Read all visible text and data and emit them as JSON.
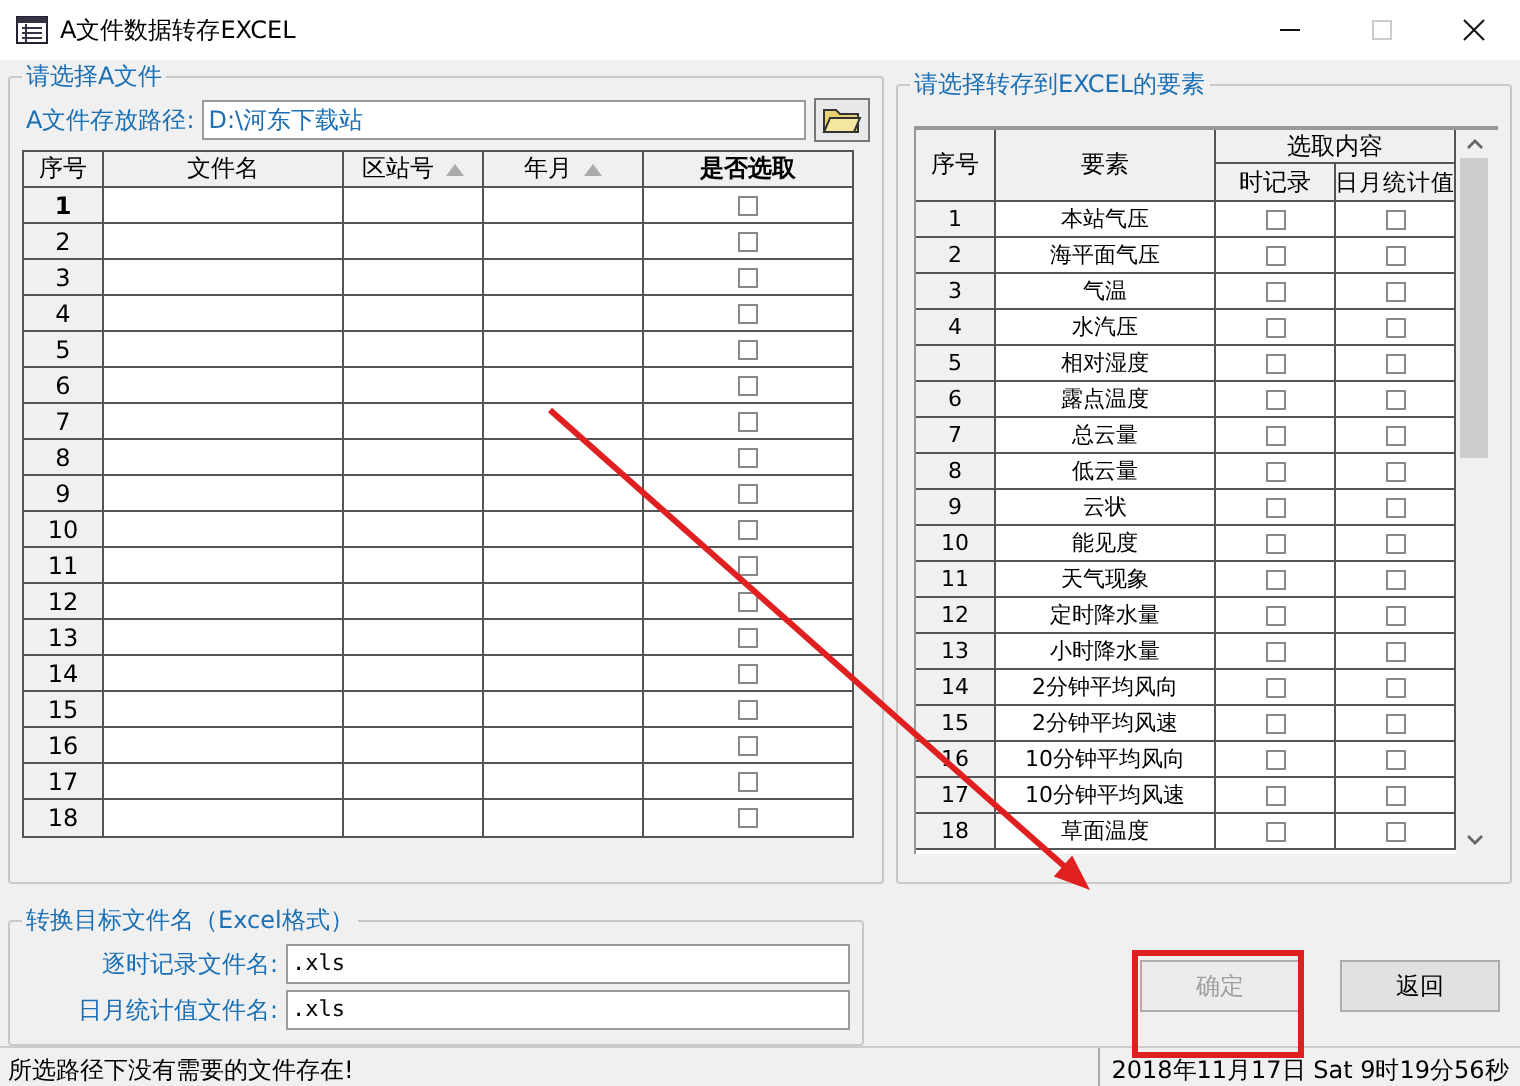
{
  "window": {
    "title": "A文件数据转存EXCEL",
    "maximize_disabled": true
  },
  "file_group": {
    "title": "请选择A文件",
    "path_label": "A文件存放路径:",
    "path_value": "D:\\河东下载站",
    "columns": [
      {
        "label": "序号",
        "sortable": false,
        "bold": false
      },
      {
        "label": "文件名",
        "sortable": false,
        "bold": false
      },
      {
        "label": "区站号",
        "sortable": true,
        "bold": false
      },
      {
        "label": "年月",
        "sortable": true,
        "bold": false
      },
      {
        "label": "是否选取",
        "sortable": false,
        "bold": true
      }
    ],
    "rows": [
      {
        "no": "1",
        "current": true,
        "checked": false
      },
      {
        "no": "2",
        "current": false,
        "checked": false
      },
      {
        "no": "3",
        "current": false,
        "checked": false
      },
      {
        "no": "4",
        "current": false,
        "checked": false
      },
      {
        "no": "5",
        "current": false,
        "checked": false
      },
      {
        "no": "6",
        "current": false,
        "checked": false
      },
      {
        "no": "7",
        "current": false,
        "checked": false
      },
      {
        "no": "8",
        "current": false,
        "checked": false
      },
      {
        "no": "9",
        "current": false,
        "checked": false
      },
      {
        "no": "10",
        "current": false,
        "checked": false
      },
      {
        "no": "11",
        "current": false,
        "checked": false
      },
      {
        "no": "12",
        "current": false,
        "checked": false
      },
      {
        "no": "13",
        "current": false,
        "checked": false
      },
      {
        "no": "14",
        "current": false,
        "checked": false
      },
      {
        "no": "15",
        "current": false,
        "checked": false
      },
      {
        "no": "16",
        "current": false,
        "checked": false
      },
      {
        "no": "17",
        "current": false,
        "checked": false
      },
      {
        "no": "18",
        "current": false,
        "checked": false
      }
    ]
  },
  "element_group": {
    "title": "请选择转存到EXCEL的要素",
    "col_no": "序号",
    "col_name": "要素",
    "col_content": "选取内容",
    "col_hourly": "时记录",
    "col_daily": "日月统计值",
    "rows": [
      {
        "no": "1",
        "name": "本站气压",
        "hourly": false,
        "daily": false
      },
      {
        "no": "2",
        "name": "海平面气压",
        "hourly": false,
        "daily": false
      },
      {
        "no": "3",
        "name": "气温",
        "hourly": false,
        "daily": false
      },
      {
        "no": "4",
        "name": "水汽压",
        "hourly": false,
        "daily": false
      },
      {
        "no": "5",
        "name": "相对湿度",
        "hourly": false,
        "daily": false
      },
      {
        "no": "6",
        "name": "露点温度",
        "hourly": false,
        "daily": false
      },
      {
        "no": "7",
        "name": "总云量",
        "hourly": false,
        "daily": false
      },
      {
        "no": "8",
        "name": "低云量",
        "hourly": false,
        "daily": false
      },
      {
        "no": "9",
        "name": "云状",
        "hourly": false,
        "daily": false
      },
      {
        "no": "10",
        "name": "能见度",
        "hourly": false,
        "daily": false
      },
      {
        "no": "11",
        "name": "天气现象",
        "hourly": false,
        "daily": false
      },
      {
        "no": "12",
        "name": "定时降水量",
        "hourly": false,
        "daily": false
      },
      {
        "no": "13",
        "name": "小时降水量",
        "hourly": false,
        "daily": false
      },
      {
        "no": "14",
        "name": "2分钟平均风向",
        "hourly": false,
        "daily": false
      },
      {
        "no": "15",
        "name": "2分钟平均风速",
        "hourly": false,
        "daily": false
      },
      {
        "no": "16",
        "name": "10分钟平均风向",
        "hourly": false,
        "daily": false
      },
      {
        "no": "17",
        "name": "10分钟平均风速",
        "hourly": false,
        "daily": false
      },
      {
        "no": "18",
        "name": "草面温度",
        "hourly": false,
        "daily": false
      }
    ]
  },
  "target_group": {
    "title": "转换目标文件名（Excel格式）",
    "fields": [
      {
        "label": "逐时记录文件名:",
        "value": ".xls"
      },
      {
        "label": "日月统计值文件名:",
        "value": ".xls"
      }
    ]
  },
  "buttons": [
    {
      "label": "确定",
      "disabled": true
    },
    {
      "label": "返回",
      "disabled": false
    }
  ],
  "status_bar": {
    "message": "所选路径下没有需要的文件存在!",
    "datetime": "2018年11月17日  Sat 9时19分56秒"
  }
}
